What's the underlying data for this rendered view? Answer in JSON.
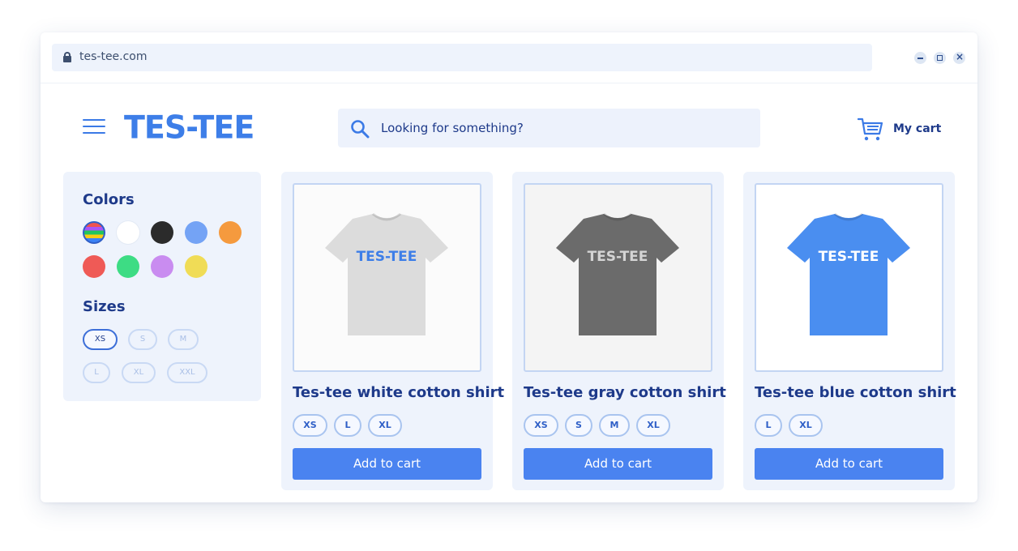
{
  "browser": {
    "url": "tes-tee.com"
  },
  "header": {
    "logo": "TES-TEE",
    "search_placeholder": "Looking for something?",
    "cart_label": "My cart"
  },
  "filters": {
    "colors_heading": "Colors",
    "colors": [
      "multicolor",
      "#ffffff",
      "#2b2b2b",
      "#74a3f5",
      "#f59a3e",
      "#ef5a56",
      "#3ddc84",
      "#c98cf0",
      "#f0dc56"
    ],
    "sizes_heading": "Sizes",
    "sizes": [
      {
        "label": "XS",
        "selected": true
      },
      {
        "label": "S",
        "selected": false
      },
      {
        "label": "M",
        "selected": false
      },
      {
        "label": "L",
        "selected": false
      },
      {
        "label": "XL",
        "selected": false
      },
      {
        "label": "XXL",
        "selected": false
      }
    ]
  },
  "products": [
    {
      "title": "Tes-tee white cotton shirt",
      "sizes": [
        "XS",
        "L",
        "XL"
      ],
      "button": "Add to cart",
      "shirt_color": "#dcdcdc",
      "print_color": "#3d7ee8",
      "print_text": "TES-TEE",
      "bg": "#fbfbfb"
    },
    {
      "title": "Tes-tee gray cotton shirt",
      "sizes": [
        "XS",
        "S",
        "M",
        "XL"
      ],
      "button": "Add to cart",
      "shirt_color": "#6b6b6b",
      "print_color": "#d4d4d4",
      "print_text": "TES-TEE",
      "bg": "#f4f4f4"
    },
    {
      "title": "Tes-tee blue cotton shirt",
      "sizes": [
        "L",
        "XL"
      ],
      "button": "Add to cart",
      "shirt_color": "#4a8ef0",
      "print_color": "#ffffff",
      "print_text": "TES-TEE",
      "bg": "#ffffff"
    }
  ]
}
